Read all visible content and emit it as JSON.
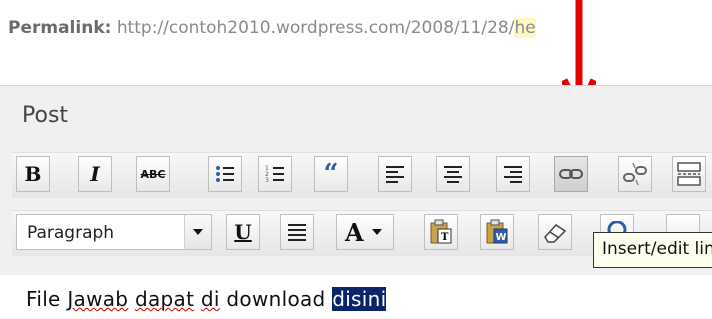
{
  "permalink": {
    "label": "Permalink:",
    "url": "http://contoh2010.wordpress.com/2008/11/28/",
    "url_tail": "he"
  },
  "post_panel": {
    "title": "Post"
  },
  "toolbar_row1": {
    "buttons": [
      "bold",
      "italic",
      "strikethrough",
      "unordered-list",
      "ordered-list",
      "blockquote",
      "align-left",
      "align-center",
      "align-right",
      "insert-edit-link",
      "unlink",
      "more-tag"
    ],
    "bold_glyph": "B",
    "italic_glyph": "I",
    "strike_glyph": "ABC",
    "quote_glyph": "66",
    "active": "insert-edit-link"
  },
  "toolbar_row2": {
    "format_select": "Paragraph",
    "underline_glyph": "U",
    "text_color_glyph": "A"
  },
  "tooltip": {
    "text": "Insert/edit link"
  },
  "editor": {
    "text_prefix": "File ",
    "word1": "Jawab",
    "word2": "dapat",
    "word3": "di",
    "word4": "download",
    "selected": "disini"
  },
  "colors": {
    "arrow": "#e00000",
    "selection": "#0a246a",
    "quote": "#2f5fa8"
  }
}
